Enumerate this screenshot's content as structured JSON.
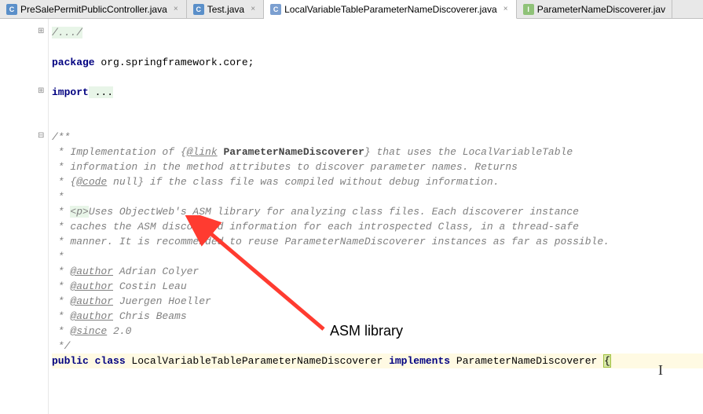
{
  "tabs": [
    {
      "label": "PreSalePermitPublicController.java",
      "iconType": "c",
      "iconText": "C"
    },
    {
      "label": "Test.java",
      "iconType": "c",
      "iconText": "C"
    },
    {
      "label": "LocalVariableTableParameterNameDiscoverer.java",
      "iconType": "cs",
      "iconText": "C"
    },
    {
      "label": "ParameterNameDiscoverer.jav",
      "iconType": "i",
      "iconText": "I"
    }
  ],
  "code": {
    "fold_comment": "/.../",
    "kw_package": "package",
    "pkg_name": " org.springframework.core;",
    "kw_import": "import",
    "import_rest": " ...",
    "doc": {
      "open": "/**",
      "l1_a": " * Implementation of {",
      "l1_link": "@link",
      "l1_ref": " ParameterNameDiscoverer",
      "l1_b": "} that uses the LocalVariableTable",
      "l2": " * information in the method attributes to discover parameter names. Returns",
      "l3_a": " * {",
      "l3_code": "@code",
      "l3_b": " null} if the class file was compiled without debug information.",
      "l4": " *",
      "l5_a": " * ",
      "l5_p": "<p>",
      "l5_b": "Uses ObjectWeb's ASM library for analyzing class files. Each discoverer instance",
      "l6": " * caches the ASM discovered information for each introspected Class, in a thread-safe",
      "l7": " * manner. It is recommended to reuse ParameterNameDiscoverer instances as far as possible.",
      "l8": " *",
      "author_tag": "@author",
      "a1": " Adrian Colyer",
      "a2": " Costin Leau",
      "a3": " Juergen Hoeller",
      "a4": " Chris Beams",
      "since_tag": "@since",
      "since_v": " 2.0",
      "close": " */"
    },
    "cls": {
      "kw_public": "public",
      "kw_class": " class ",
      "name": "LocalVariableTableParameterNameDiscoverer ",
      "kw_implements": "implements",
      "iface": " ParameterNameDiscoverer ",
      "brace": "{"
    }
  },
  "annotation": {
    "label": "ASM library",
    "arrow_color": "#ff3b30"
  }
}
